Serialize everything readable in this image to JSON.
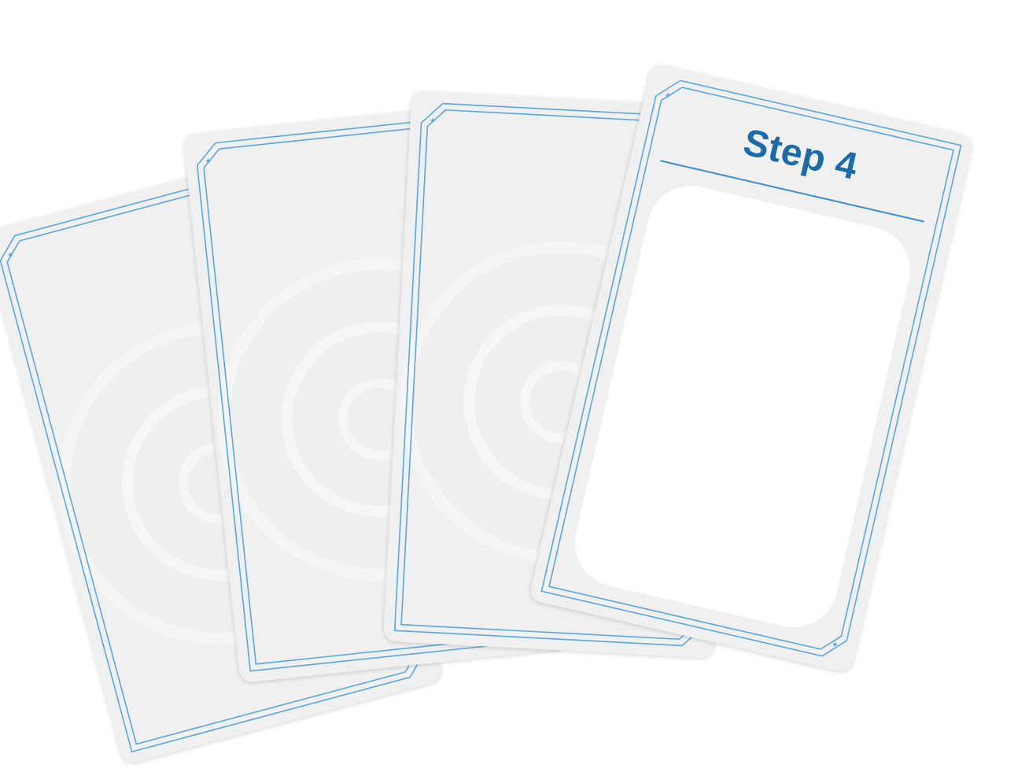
{
  "cards": [
    {
      "id": "card-1",
      "face": "back"
    },
    {
      "id": "card-2",
      "face": "back"
    },
    {
      "id": "card-3",
      "face": "back"
    },
    {
      "id": "card-4",
      "face": "front",
      "title": "Step 4"
    }
  ],
  "colors": {
    "frame_line": "#5aa7dd",
    "title_text": "#1a6ba8",
    "title_rule": "#3f8fd0",
    "card_bg": "#f0f0f0",
    "art_window": "#ffffff"
  },
  "icons": {
    "corner_ornament": "sparkle-icon"
  }
}
